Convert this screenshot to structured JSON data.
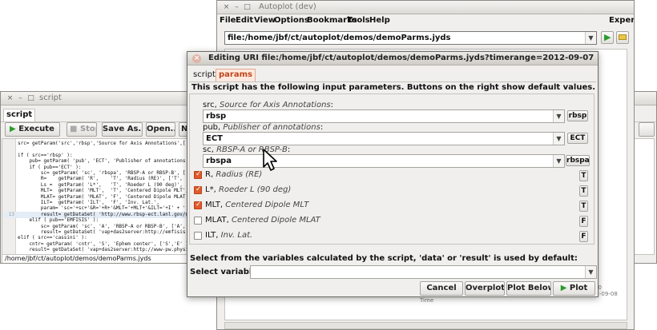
{
  "script_window": {
    "title": "script",
    "tab": "script",
    "toolbar": {
      "execute": "Execute",
      "stop": "Stop",
      "save_as": "Save As...",
      "open": "Open...",
      "new": "Ne"
    },
    "code_lines": [
      {
        "n": "",
        "t": "src= getParam('src','rbsp','Source for Axis Annotations',['r"
      },
      {
        "n": "",
        "t": ""
      },
      {
        "n": "",
        "t": "if ( src=='rbsp' ):"
      },
      {
        "n": "",
        "t": "    pub= getParam( 'pub', 'ECT', 'Publisher of annotations',["
      },
      {
        "n": "",
        "t": "    if ( pub=='ECT' ):"
      },
      {
        "n": "",
        "t": "        sc= getParam( 'sc', 'rbspa', 'RBSP-A or RBSP-B', ['"
      },
      {
        "n": "",
        "t": "        R=    getParam( 'R',    'T', 'Radius (RE)', ['T',"
      },
      {
        "n": "",
        "t": "        Ls =  getParam( 'L*',   'T', 'Roeder L (90 deg)',"
      },
      {
        "n": "",
        "t": "        MLT=  getParam( 'MLT',  'T', 'Centered Dipole MLT',"
      },
      {
        "n": "",
        "t": "        MLAT= getParam( 'MLAT', 'F', 'Centered Dipole MLAT',"
      },
      {
        "n": "",
        "t": "        ILT=  getParam( 'ILT',  'F', 'Inv. Lat.',"
      },
      {
        "n": "",
        "t": "        param= 'sc='+sc+'&R='+R+'&MLT='+MLT+'&ILT='+I' + '"
      },
      {
        "n": "13",
        "t": "        result= getDataSet( 'http://www.rbsp-ect.lanl.gov/da"
      },
      {
        "n": "",
        "t": "    elif ( pub=='EMFISIS' ):"
      },
      {
        "n": "",
        "t": "        sc= getParam( 'sc', 'A', 'RBSP-A or RBSP-B', ['A','B"
      },
      {
        "n": "",
        "t": "        result= getDataSet( 'vap+das2server:http://emfisis.p"
      },
      {
        "n": "",
        "t": "elif ( src=='cassini' ):"
      },
      {
        "n": "",
        "t": "    cntr= getParam( 'cntr', 'S', 'Ephem center', ['S','E' ]"
      },
      {
        "n": "",
        "t": "    result= getDataSet( 'vap+das2server:http://www-pw.physic"
      }
    ],
    "status_path": "/home/jbf/ct/autoplot/demos/demoParms.jyds"
  },
  "autoplot_window": {
    "title": "Autoplot (dev)",
    "menus": [
      "File",
      "Edit",
      "View",
      "Options",
      "Bookmarks",
      "Tools",
      "Help"
    ],
    "expert": "Expert",
    "uri": "file:/home/jbf/ct/autoplot/demos/demoParms.jyds",
    "plot_label_tail": "00",
    "plot_label_date": "12-09-08",
    "plot_label_time": "Time"
  },
  "dialog": {
    "title": "Editing URI file:/home/jbf/ct/autoplot/demos/demoParms.jyds?timerange=2012-09-07",
    "tabs": [
      "script",
      "params"
    ],
    "intro": "This script has the following input parameters. Buttons on the right show default values.",
    "params": [
      {
        "name": "src,",
        "desc": "Source for Axis Annotations",
        "suffix": ":",
        "value": "rbsp",
        "default": "rbsp"
      },
      {
        "name": "pub,",
        "desc": "Publisher of annotations",
        "suffix": ":",
        "value": "ECT",
        "default": "ECT"
      },
      {
        "name": "sc,",
        "desc": "RBSP-A or RBSP-B",
        "suffix": ":",
        "value": "rbspa",
        "default": "rbspa"
      }
    ],
    "checks": [
      {
        "name": "R,",
        "desc": "Radius (RE)",
        "checked": true,
        "default": "T"
      },
      {
        "name": "L*,",
        "desc": "Roeder L (90 deg)",
        "checked": true,
        "default": "T"
      },
      {
        "name": "MLT,",
        "desc": "Centered Dipole MLT",
        "checked": true,
        "default": "T"
      },
      {
        "name": "MLAT,",
        "desc": "Centered Dipole MLAT",
        "checked": false,
        "default": "F"
      },
      {
        "name": "ILT,",
        "desc": "Inv. Lat.",
        "checked": false,
        "default": "F"
      }
    ],
    "select_prompt": "Select from the variables calculated by the script, 'data' or 'result' is used by default:",
    "select_label": "Select variable:",
    "select_value": "",
    "buttons": {
      "cancel": "Cancel",
      "overplot": "Overplot",
      "plot_below": "Plot Below",
      "plot": "Plot"
    }
  },
  "colors": {
    "checked": "#e05a2b",
    "play_green": "#2e9b2e"
  }
}
